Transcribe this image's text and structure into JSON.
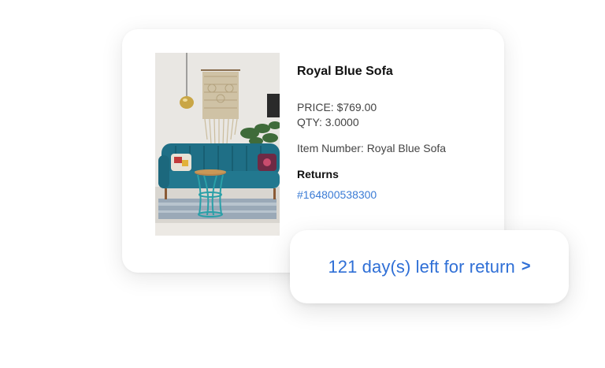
{
  "product": {
    "title": "Royal Blue Sofa",
    "price_label": "PRICE: $769.00",
    "qty_label": "QTY: 3.0000",
    "item_number_label": "Item Number: Royal Blue Sofa",
    "returns_heading": "Returns",
    "return_id": "#164800538300",
    "image_alt": "Royal Blue Sofa"
  },
  "return_pill": {
    "text": "121 day(s) left for return",
    "arrow": ">"
  },
  "colors": {
    "link_blue": "#3a7bd5",
    "sofa_teal": "#1e6f86"
  }
}
